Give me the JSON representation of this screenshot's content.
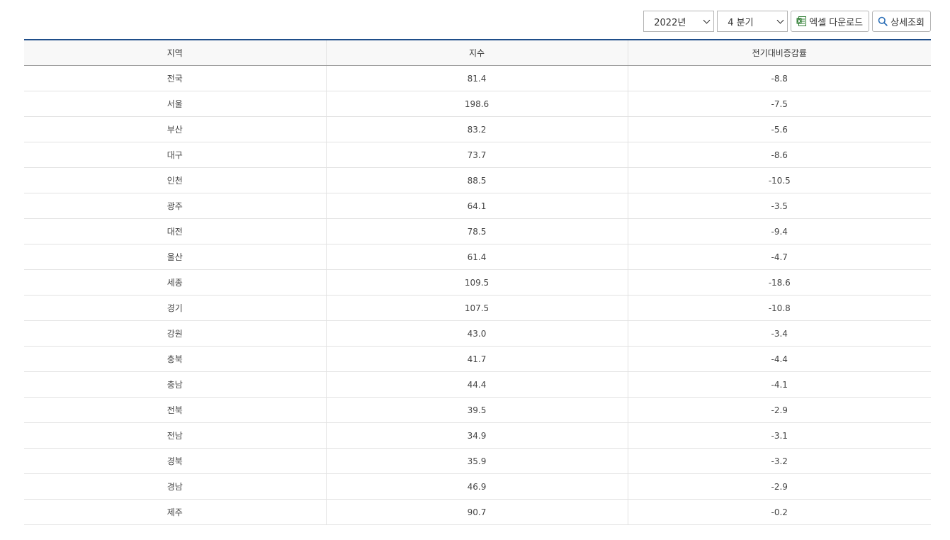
{
  "toolbar": {
    "year_value": "2022년",
    "quarter_value": "4 분기",
    "excel_label": "엑셀 다운로드",
    "detail_label": "상세조회",
    "excel_icon": "excel-icon",
    "detail_icon": "search-icon",
    "accent_color": "#1f4e8a"
  },
  "table": {
    "headers": [
      "지역",
      "지수",
      "전기대비증감률"
    ],
    "rows": [
      {
        "region": "전국",
        "index": "81.4",
        "change": "-8.8"
      },
      {
        "region": "서울",
        "index": "198.6",
        "change": "-7.5"
      },
      {
        "region": "부산",
        "index": "83.2",
        "change": "-5.6"
      },
      {
        "region": "대구",
        "index": "73.7",
        "change": "-8.6"
      },
      {
        "region": "인천",
        "index": "88.5",
        "change": "-10.5"
      },
      {
        "region": "광주",
        "index": "64.1",
        "change": "-3.5"
      },
      {
        "region": "대전",
        "index": "78.5",
        "change": "-9.4"
      },
      {
        "region": "울산",
        "index": "61.4",
        "change": "-4.7"
      },
      {
        "region": "세종",
        "index": "109.5",
        "change": "-18.6"
      },
      {
        "region": "경기",
        "index": "107.5",
        "change": "-10.8"
      },
      {
        "region": "강원",
        "index": "43.0",
        "change": "-3.4"
      },
      {
        "region": "충북",
        "index": "41.7",
        "change": "-4.4"
      },
      {
        "region": "충남",
        "index": "44.4",
        "change": "-4.1"
      },
      {
        "region": "전북",
        "index": "39.5",
        "change": "-2.9"
      },
      {
        "region": "전남",
        "index": "34.9",
        "change": "-3.1"
      },
      {
        "region": "경북",
        "index": "35.9",
        "change": "-3.2"
      },
      {
        "region": "경남",
        "index": "46.9",
        "change": "-2.9"
      },
      {
        "region": "제주",
        "index": "90.7",
        "change": "-0.2"
      }
    ]
  }
}
